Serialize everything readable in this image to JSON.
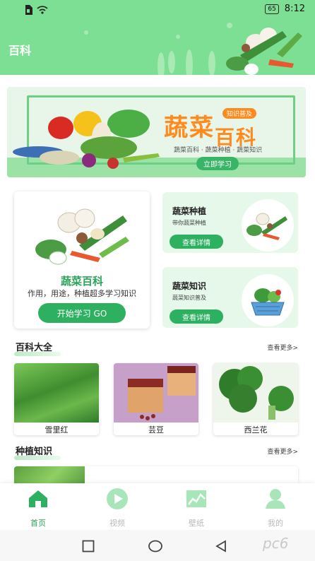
{
  "status_bar": {
    "time": "8:12",
    "battery": "65",
    "icons": [
      "sim-icon",
      "wifi-icon",
      "battery-icon"
    ]
  },
  "header": {
    "title": "百科"
  },
  "banner": {
    "title_main": "蔬菜",
    "title_end": "百科",
    "tag": "知识普及",
    "subtitle": "蔬菜百科 · 蔬菜种植 · 蔬菜知识",
    "button": "立即学习"
  },
  "feature_card": {
    "title": "蔬菜百科",
    "subtitle": "作用，用途，种植超多学习知识",
    "button": "开始学习 GO"
  },
  "side_cards": [
    {
      "title": "蔬菜种植",
      "subtitle": "带你蔬菜种植",
      "button": "查看详情"
    },
    {
      "title": "蔬菜知识",
      "subtitle": "蔬菜知识普及",
      "button": "查看详情"
    }
  ],
  "encyclopedia": {
    "title": "百科大全",
    "more": "查看更多>",
    "items": [
      {
        "label": "雪里红"
      },
      {
        "label": "芸豆"
      },
      {
        "label": "西兰花"
      }
    ]
  },
  "planting": {
    "title": "种植知识",
    "more": "查看更多>"
  },
  "tabs": [
    {
      "label": "首页",
      "icon": "home-icon",
      "active": true
    },
    {
      "label": "视频",
      "icon": "play-icon",
      "active": false
    },
    {
      "label": "壁纸",
      "icon": "chart-icon",
      "active": false
    },
    {
      "label": "我的",
      "icon": "user-icon",
      "active": false
    }
  ],
  "system_nav": [
    "square-icon",
    "circle-icon",
    "back-triangle-icon"
  ],
  "watermark": "pc6",
  "colors": {
    "primary_green": "#2db05f",
    "header_green": "#7ddf93",
    "accent_orange": "#ff8a1e"
  }
}
